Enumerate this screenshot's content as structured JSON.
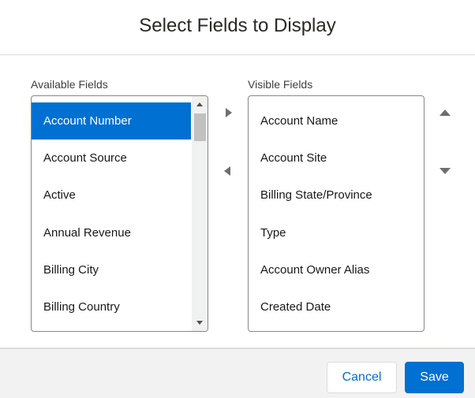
{
  "modal": {
    "title": "Select Fields to Display"
  },
  "available": {
    "label": "Available Fields",
    "items": [
      {
        "label": "Account Number",
        "selected": true
      },
      {
        "label": "Account Source",
        "selected": false
      },
      {
        "label": "Active",
        "selected": false
      },
      {
        "label": "Annual Revenue",
        "selected": false
      },
      {
        "label": "Billing City",
        "selected": false
      },
      {
        "label": "Billing Country",
        "selected": false
      }
    ]
  },
  "visible": {
    "label": "Visible Fields",
    "items": [
      {
        "label": "Account Name"
      },
      {
        "label": "Account Site"
      },
      {
        "label": "Billing State/Province"
      },
      {
        "label": "Type"
      },
      {
        "label": "Account Owner Alias"
      },
      {
        "label": "Created Date"
      }
    ]
  },
  "icons": {
    "move_right": "chevron-right-icon",
    "move_left": "chevron-left-icon",
    "move_up": "chevron-up-icon",
    "move_down": "chevron-down-icon"
  },
  "footer": {
    "cancel_label": "Cancel",
    "save_label": "Save"
  },
  "colors": {
    "brand": "#0070d2",
    "footer_bg": "#f3f2f2",
    "border": "#dddbda"
  }
}
